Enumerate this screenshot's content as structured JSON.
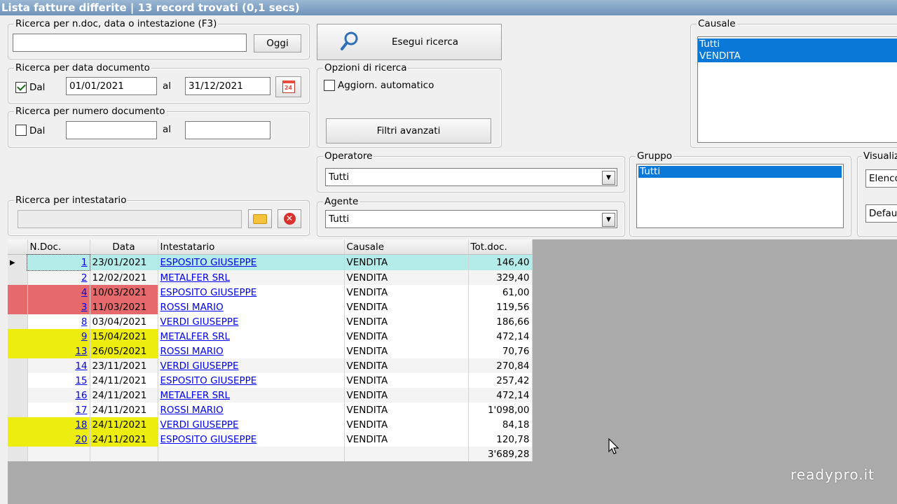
{
  "window": {
    "title": "Lista fatture differite | 13 record trovati (0,1 secs)"
  },
  "search_text": {
    "legend": "Ricerca per n.doc, data o intestazione (F3)",
    "value": "",
    "today_button": "Oggi"
  },
  "date_search": {
    "legend": "Ricerca per data documento",
    "checkbox_label": "Dal",
    "checked": true,
    "from": "01/01/2021",
    "to_label": "al",
    "to": "31/12/2021",
    "calendar_day": "24"
  },
  "number_search": {
    "legend": "Ricerca per numero documento",
    "checkbox_label": "Dal",
    "checked": false,
    "from": "",
    "to_label": "al",
    "to": ""
  },
  "holder_search": {
    "legend": "Ricerca per intestatario",
    "value": ""
  },
  "run_search": {
    "label": "Esegui ricerca"
  },
  "search_options": {
    "legend": "Opzioni di ricerca",
    "auto_update_label": "Aggiorn. automatico",
    "auto_update": false,
    "advanced_filters": "Filtri avanzati"
  },
  "causale": {
    "legend": "Causale",
    "items": [
      "Tutti",
      "VENDITA"
    ]
  },
  "operatore": {
    "legend": "Operatore",
    "value": "Tutti"
  },
  "agente": {
    "legend": "Agente",
    "value": "Tutti"
  },
  "gruppo": {
    "legend": "Gruppo",
    "items": [
      "Tutti"
    ]
  },
  "visualizza": {
    "legend": "Visualiz",
    "combo1": "Elenco",
    "combo2": "Defaul"
  },
  "grid": {
    "headers": [
      "N.Doc.",
      "Data",
      "Intestatario",
      "Causale",
      "Tot.doc."
    ],
    "rows": [
      {
        "ndoc": "1",
        "data": "23/01/2021",
        "intestatario": "ESPOSITO GIUSEPPE",
        "causale": "VENDITA",
        "tot": "146,40",
        "color": "#b4ecea",
        "current": true
      },
      {
        "ndoc": "2",
        "data": "12/02/2021",
        "intestatario": "METALFER SRL",
        "causale": "VENDITA",
        "tot": "329,40",
        "color": "",
        "current": false
      },
      {
        "ndoc": "4",
        "data": "10/03/2021",
        "intestatario": "ESPOSITO GIUSEPPE",
        "causale": "VENDITA",
        "tot": "61,00",
        "color": "#e6696b",
        "current": false
      },
      {
        "ndoc": "3",
        "data": "11/03/2021",
        "intestatario": "ROSSI MARIO",
        "causale": "VENDITA",
        "tot": "119,56",
        "color": "#e6696b",
        "current": false
      },
      {
        "ndoc": "8",
        "data": "03/04/2021",
        "intestatario": "VERDI GIUSEPPE",
        "causale": "VENDITA",
        "tot": "186,66",
        "color": "",
        "current": false
      },
      {
        "ndoc": "9",
        "data": "15/04/2021",
        "intestatario": "METALFER SRL",
        "causale": "VENDITA",
        "tot": "472,14",
        "color": "#eded10",
        "current": false
      },
      {
        "ndoc": "13",
        "data": "26/05/2021",
        "intestatario": "ROSSI MARIO",
        "causale": "VENDITA",
        "tot": "70,76",
        "color": "#eded10",
        "current": false
      },
      {
        "ndoc": "14",
        "data": "23/11/2021",
        "intestatario": "VERDI GIUSEPPE",
        "causale": "VENDITA",
        "tot": "270,84",
        "color": "",
        "current": false
      },
      {
        "ndoc": "15",
        "data": "24/11/2021",
        "intestatario": "ESPOSITO GIUSEPPE",
        "causale": "VENDITA",
        "tot": "257,42",
        "color": "",
        "current": false
      },
      {
        "ndoc": "16",
        "data": "24/11/2021",
        "intestatario": "METALFER SRL",
        "causale": "VENDITA",
        "tot": "472,14",
        "color": "",
        "current": false
      },
      {
        "ndoc": "17",
        "data": "24/11/2021",
        "intestatario": "ROSSI MARIO",
        "causale": "VENDITA",
        "tot": "1'098,00",
        "color": "",
        "current": false
      },
      {
        "ndoc": "18",
        "data": "24/11/2021",
        "intestatario": "VERDI GIUSEPPE",
        "causale": "VENDITA",
        "tot": "84,18",
        "color": "#eded10",
        "current": false
      },
      {
        "ndoc": "20",
        "data": "24/11/2021",
        "intestatario": "ESPOSITO GIUSEPPE",
        "causale": "VENDITA",
        "tot": "120,78",
        "color": "#eded10",
        "current": false
      }
    ],
    "total": "3'689,28"
  },
  "watermark": "readypro.it",
  "colors": {
    "selection": "#0a78d7",
    "current_row": "#b4ecea",
    "red_row": "#e6696b",
    "yellow_row": "#eded10",
    "grid_background": "#ababab"
  }
}
